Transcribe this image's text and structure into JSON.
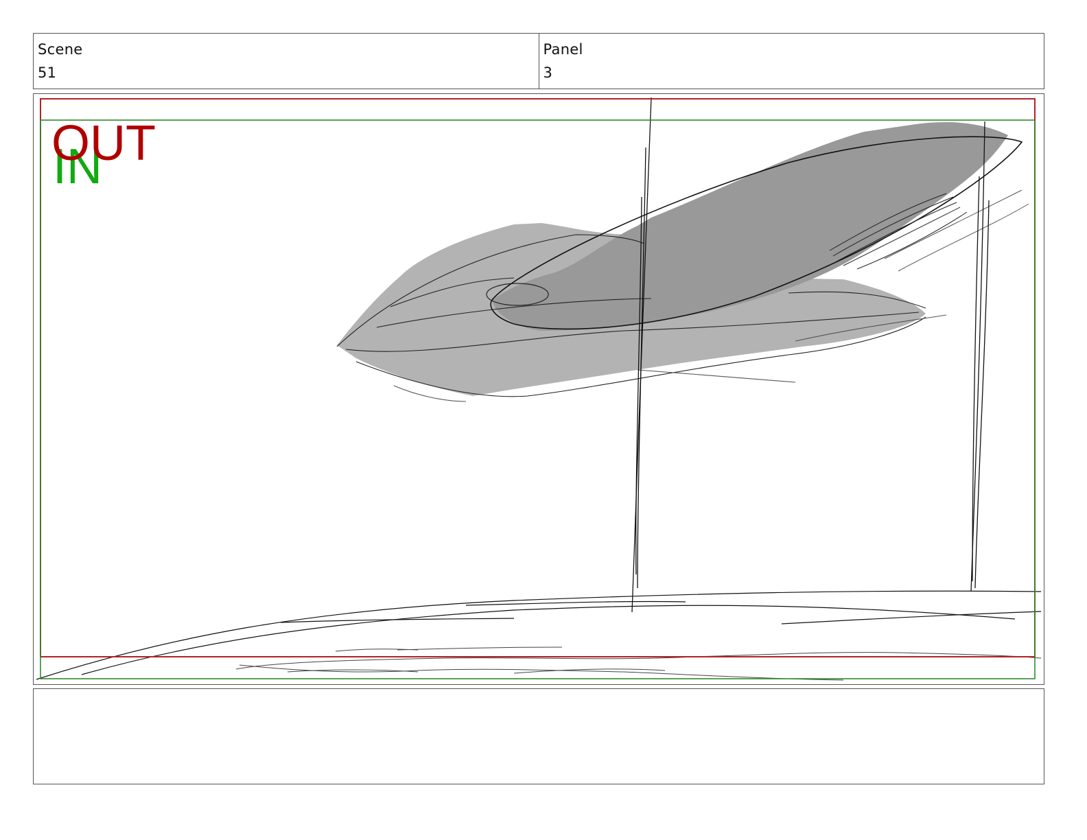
{
  "header": {
    "scene_label": "Scene",
    "scene_value": "51",
    "panel_label": "Panel",
    "panel_value": "3"
  },
  "panel": {
    "out_label": "OUT",
    "in_label": "IN",
    "colors": {
      "out_frame": "#b22222",
      "in_frame": "#2e8b2e",
      "out_text": "#b00000",
      "in_text": "#11aa11",
      "sketch_light_fill": "#b3b3b3",
      "sketch_dark_fill": "#999999",
      "sketch_line": "#111111"
    }
  },
  "notes": {
    "text": ""
  }
}
